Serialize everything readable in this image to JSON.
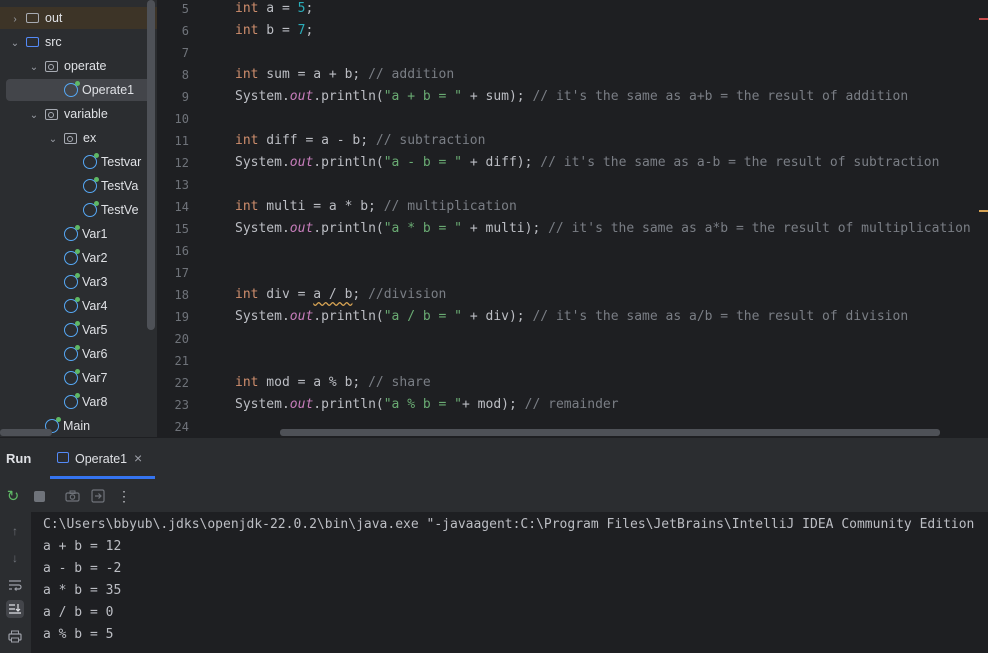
{
  "project_tree": {
    "items": [
      {
        "label": "out",
        "type": "folder",
        "indent": 0,
        "expanded": false
      },
      {
        "label": "src",
        "type": "source-folder",
        "indent": 0,
        "expanded": true
      },
      {
        "label": "operate",
        "type": "package",
        "indent": 1,
        "expanded": true
      },
      {
        "label": "Operate1",
        "type": "class",
        "indent": 2,
        "selected": true
      },
      {
        "label": "variable",
        "type": "package",
        "indent": 1,
        "expanded": true
      },
      {
        "label": "ex",
        "type": "package",
        "indent": 2,
        "expanded": true
      },
      {
        "label": "Testvar",
        "type": "class",
        "indent": 3
      },
      {
        "label": "TestVa",
        "type": "class",
        "indent": 3
      },
      {
        "label": "TestVe",
        "type": "class",
        "indent": 3
      },
      {
        "label": "Var1",
        "type": "class",
        "indent": 2
      },
      {
        "label": "Var2",
        "type": "class",
        "indent": 2
      },
      {
        "label": "Var3",
        "type": "class",
        "indent": 2
      },
      {
        "label": "Var4",
        "type": "class",
        "indent": 2
      },
      {
        "label": "Var5",
        "type": "class",
        "indent": 2
      },
      {
        "label": "Var6",
        "type": "class",
        "indent": 2
      },
      {
        "label": "Var7",
        "type": "class",
        "indent": 2
      },
      {
        "label": "Var8",
        "type": "class",
        "indent": 2
      },
      {
        "label": "Main",
        "type": "class",
        "indent": 1
      }
    ]
  },
  "editor": {
    "lines": [
      {
        "n": "5",
        "tokens": [
          [
            "kw",
            "int"
          ],
          [
            "p",
            " a = "
          ],
          [
            "num",
            "5"
          ],
          [
            "p",
            ";"
          ]
        ]
      },
      {
        "n": "6",
        "tokens": [
          [
            "kw",
            "int"
          ],
          [
            "p",
            " b = "
          ],
          [
            "num",
            "7"
          ],
          [
            "p",
            ";"
          ]
        ]
      },
      {
        "n": "7",
        "tokens": []
      },
      {
        "n": "8",
        "tokens": [
          [
            "kw",
            "int"
          ],
          [
            "p",
            " sum = a + b; "
          ],
          [
            "cm",
            "// addition"
          ]
        ]
      },
      {
        "n": "9",
        "tokens": [
          [
            "p",
            "System."
          ],
          [
            "fld",
            "out"
          ],
          [
            "p",
            ".println("
          ],
          [
            "str",
            "\"a + b = \""
          ],
          [
            "p",
            " + sum); "
          ],
          [
            "cm",
            "// it's the same as a+b = the result of addition"
          ]
        ]
      },
      {
        "n": "10",
        "tokens": []
      },
      {
        "n": "11",
        "tokens": [
          [
            "kw",
            "int"
          ],
          [
            "p",
            " diff = a - b; "
          ],
          [
            "cm",
            "// subtraction"
          ]
        ]
      },
      {
        "n": "12",
        "tokens": [
          [
            "p",
            "System."
          ],
          [
            "fld",
            "out"
          ],
          [
            "p",
            ".println("
          ],
          [
            "str",
            "\"a - b = \""
          ],
          [
            "p",
            " + diff); "
          ],
          [
            "cm",
            "// it's the same as a-b = the result of subtraction"
          ]
        ]
      },
      {
        "n": "13",
        "tokens": []
      },
      {
        "n": "14",
        "tokens": [
          [
            "kw",
            "int"
          ],
          [
            "p",
            " multi = a * b; "
          ],
          [
            "cm",
            "// multiplication"
          ]
        ]
      },
      {
        "n": "15",
        "tokens": [
          [
            "p",
            "System."
          ],
          [
            "fld",
            "out"
          ],
          [
            "p",
            ".println("
          ],
          [
            "str",
            "\"a * b = \""
          ],
          [
            "p",
            " + multi); "
          ],
          [
            "cm",
            "// it's the same as a*b = the result of multiplication"
          ]
        ]
      },
      {
        "n": "16",
        "tokens": []
      },
      {
        "n": "17",
        "tokens": []
      },
      {
        "n": "18",
        "tokens": [
          [
            "kw",
            "int"
          ],
          [
            "p",
            " div = "
          ],
          [
            "squig",
            "a / b"
          ],
          [
            "p",
            "; "
          ],
          [
            "cm",
            "//division"
          ]
        ]
      },
      {
        "n": "19",
        "tokens": [
          [
            "p",
            "System."
          ],
          [
            "fld",
            "out"
          ],
          [
            "p",
            ".println("
          ],
          [
            "str",
            "\"a / b = \""
          ],
          [
            "p",
            " + div); "
          ],
          [
            "cm",
            "// it's the same as a/b = the result of division"
          ]
        ]
      },
      {
        "n": "20",
        "tokens": []
      },
      {
        "n": "21",
        "tokens": []
      },
      {
        "n": "22",
        "tokens": [
          [
            "kw",
            "int"
          ],
          [
            "p",
            " mod = a % b; "
          ],
          [
            "cm",
            "// share"
          ]
        ]
      },
      {
        "n": "23",
        "tokens": [
          [
            "p",
            "System."
          ],
          [
            "fld",
            "out"
          ],
          [
            "p",
            ".println("
          ],
          [
            "str",
            "\"a % b = \""
          ],
          [
            "p",
            "+ mod); "
          ],
          [
            "cm",
            "// remainder"
          ]
        ]
      },
      {
        "n": "24",
        "tokens": []
      }
    ]
  },
  "run_panel": {
    "title": "Run",
    "tab_label": "Operate1",
    "tab_close": "×",
    "console_lines": [
      "C:\\Users\\bbyub\\.jdks\\openjdk-22.0.2\\bin\\java.exe \"-javaagent:C:\\Program Files\\JetBrains\\IntelliJ IDEA Community Edition",
      "a + b = 12",
      "a - b = -2",
      "a * b = 35",
      "a / b = 0",
      "a % b = 5"
    ]
  },
  "colors": {
    "accent": "#3574f0",
    "keyword": "#cf8e6d",
    "number": "#2aacb8",
    "string": "#6aab73",
    "comment": "#7a7e85",
    "static_field": "#c77dbb"
  }
}
